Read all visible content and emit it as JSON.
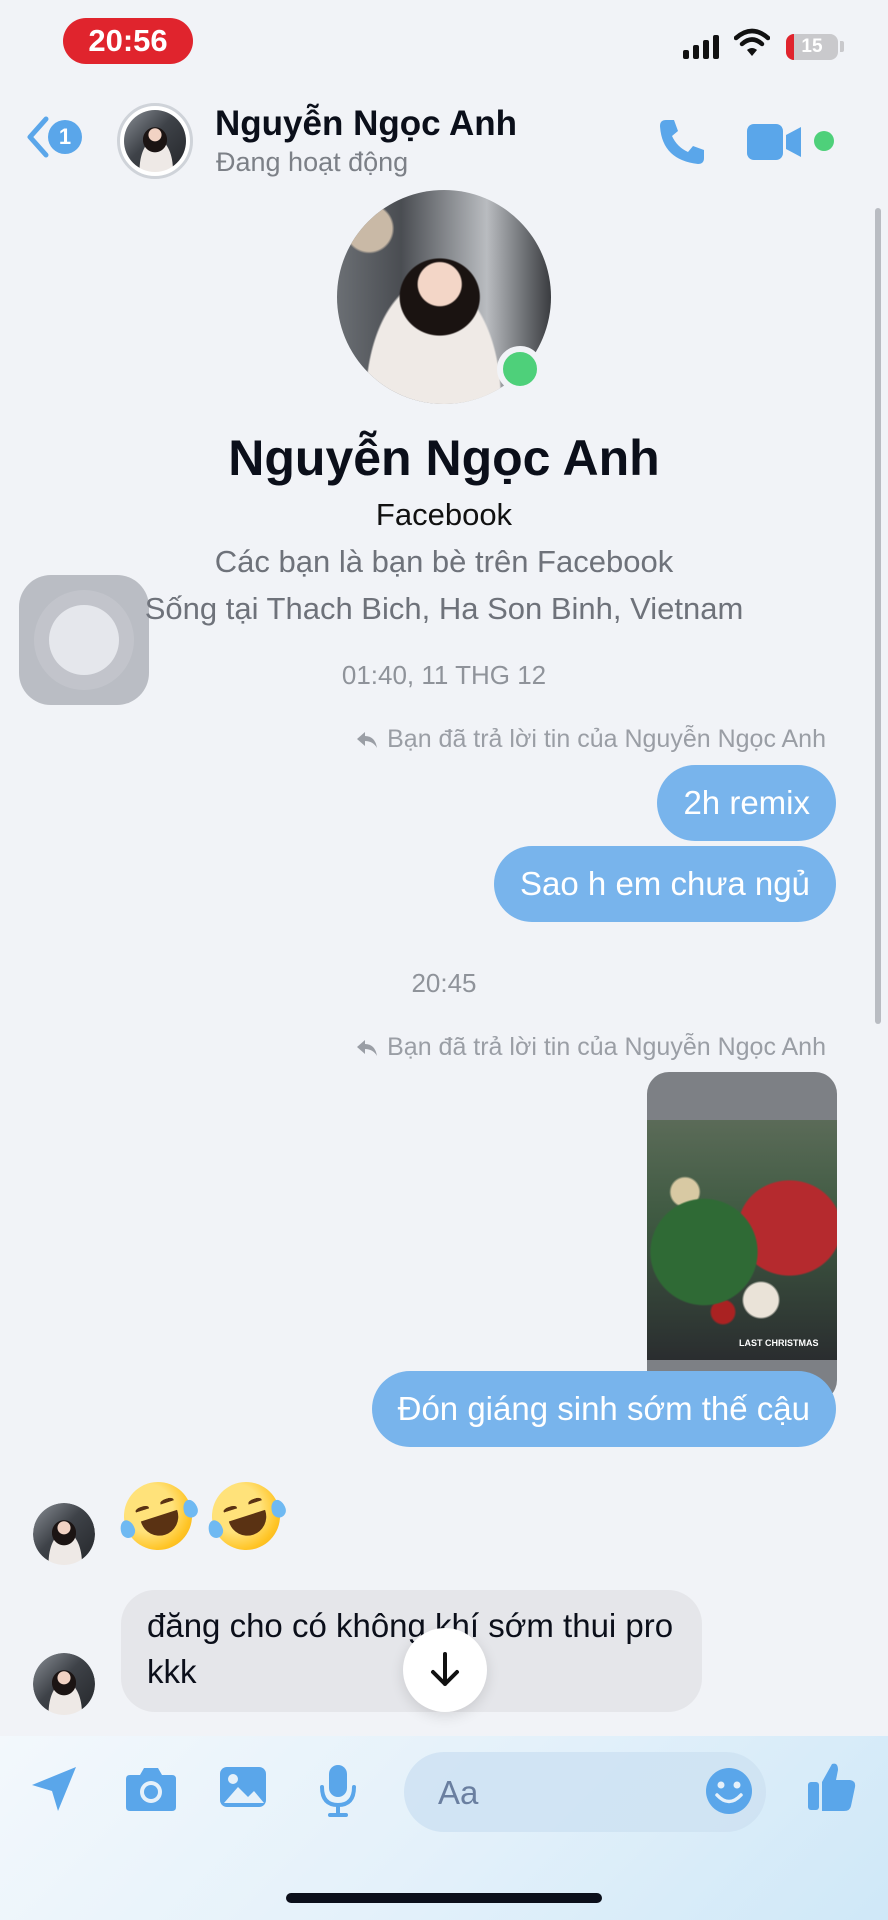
{
  "status_bar": {
    "time": "20:56",
    "battery": "15",
    "battery_level": 0.15,
    "icons": [
      "signal-icon",
      "wifi-icon",
      "battery-icon"
    ]
  },
  "header": {
    "back_badge": "1",
    "name": "Nguyễn Ngọc Anh",
    "status": "Đang hoạt động",
    "actions": [
      "phone-icon",
      "video-call-icon"
    ]
  },
  "profile": {
    "name": "Nguyễn Ngọc Anh",
    "platform": "Facebook",
    "friends_line": "Các bạn là bạn bè trên Facebook",
    "location_line": "Sống tại Thach Bich, Ha Son Binh, Vietnam"
  },
  "conversation": {
    "timestamp_1": "01:40, 11 THG 12",
    "reply_label_1": "Bạn đã trả lời tin của Nguyễn Ngọc Anh",
    "out_1": "2h remix",
    "out_2": "Sao h em chưa ngủ",
    "timestamp_2": "20:45",
    "reply_label_2": "Bạn đã trả lời tin của Nguyễn Ngọc Anh",
    "video_caption": "LAST CHRISTMAS",
    "out_3": "Đón giáng sinh sớm thế cậu",
    "emoji_reaction": "🤣🤣",
    "in_1": "đăng cho có không khí sớm thui pro kkk"
  },
  "composer": {
    "placeholder": "Aa",
    "icons": [
      "send-location-icon",
      "camera-icon",
      "gallery-icon",
      "microphone-icon",
      "emoji-icon",
      "like-icon"
    ]
  },
  "colors": {
    "accent": "#5aa6ea",
    "outgoing_bubble": "#78b4ec",
    "incoming_bubble": "#e5e6ea",
    "online": "#4ed07a",
    "status_time_bg": "#e0242d"
  }
}
